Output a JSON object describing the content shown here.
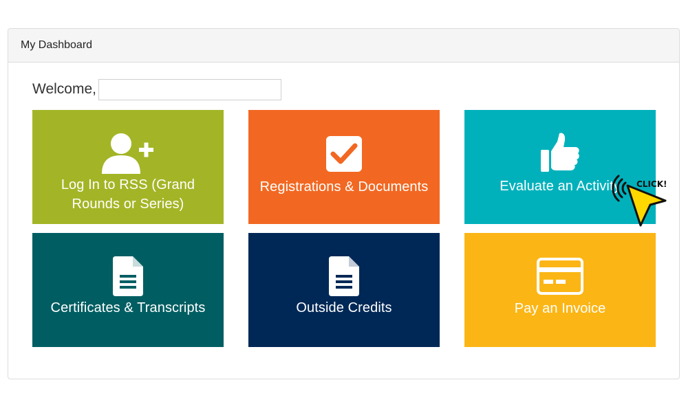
{
  "panel": {
    "title": "My Dashboard"
  },
  "welcome": {
    "label": "Welcome,",
    "name_value": ""
  },
  "tiles": [
    {
      "label": "Log In to RSS (Grand Rounds or Series)",
      "icon": "add-user-icon",
      "color": "#a3b526"
    },
    {
      "label": "Registrations & Documents",
      "icon": "checkbox-icon",
      "color": "#f26822"
    },
    {
      "label": "Evaluate an Activity",
      "icon": "thumbs-up-icon",
      "color": "#00b1bc"
    },
    {
      "label": "Certificates & Transcripts",
      "icon": "document-icon",
      "color": "#005e62"
    },
    {
      "label": "Outside Credits",
      "icon": "document-icon",
      "color": "#002856"
    },
    {
      "label": "Pay an Invoice",
      "icon": "credit-card-icon",
      "color": "#fbb616"
    }
  ],
  "overlay": {
    "click_text": "CLICK!",
    "cursor_color": "#ffd800"
  }
}
